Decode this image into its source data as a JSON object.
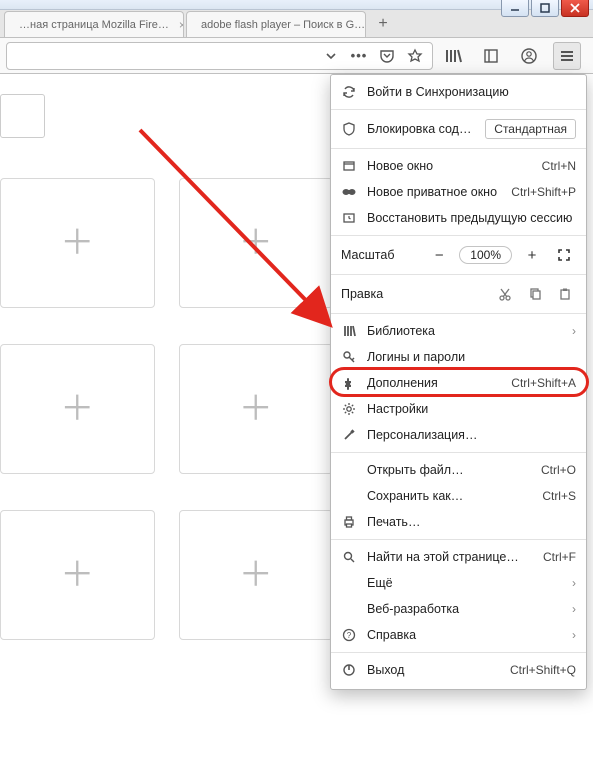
{
  "tabs": [
    {
      "title": "…ная страница Mozilla Fire…"
    },
    {
      "title": "adobe flash player – Поиск в G…"
    }
  ],
  "toolbar_icons": {
    "dropdown": "chevron-down-icon",
    "dots": "page-actions-icon",
    "pocket": "pocket-icon",
    "star": "bookmark-star-icon",
    "library": "library-icon",
    "sidebar": "sidebar-icon",
    "account": "account-icon",
    "menu": "hamburger-menu-icon"
  },
  "zoom": {
    "label": "Масштаб",
    "value": "100%"
  },
  "edit": {
    "label": "Правка"
  },
  "menu": {
    "sync": "Войти в Синхронизацию",
    "content_blocking": {
      "label": "Блокировка содержимого",
      "pill": "Стандартная"
    },
    "new_window": {
      "label": "Новое окно",
      "accel": "Ctrl+N"
    },
    "new_private": {
      "label": "Новое приватное окно",
      "accel": "Ctrl+Shift+P"
    },
    "restore_session": "Восстановить предыдущую сессию",
    "library": "Библиотека",
    "logins": "Логины и пароли",
    "addons": {
      "label": "Дополнения",
      "accel": "Ctrl+Shift+A"
    },
    "settings": "Настройки",
    "customize": "Персонализация…",
    "open_file": {
      "label": "Открыть файл…",
      "accel": "Ctrl+O"
    },
    "save_as": {
      "label": "Сохранить как…",
      "accel": "Ctrl+S"
    },
    "print": "Печать…",
    "find": {
      "label": "Найти на этой странице…",
      "accel": "Ctrl+F"
    },
    "more": "Ещё",
    "webdev": "Веб-разработка",
    "help": "Справка",
    "exit": {
      "label": "Выход",
      "accel": "Ctrl+Shift+Q"
    }
  }
}
